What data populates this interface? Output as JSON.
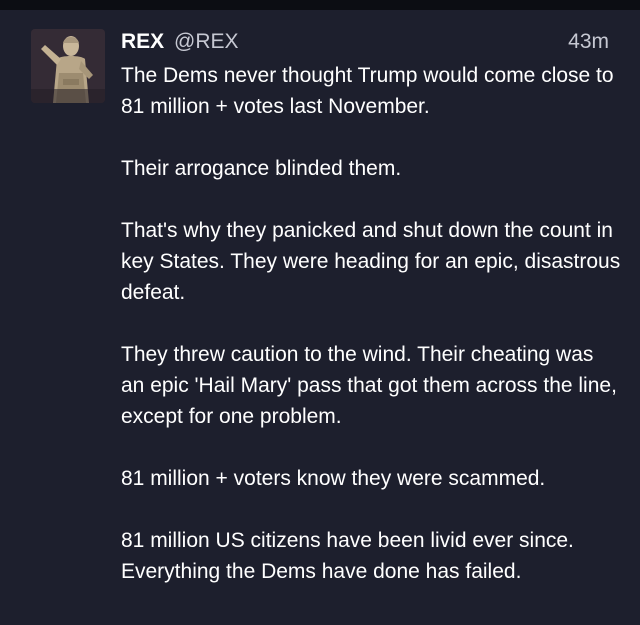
{
  "post": {
    "display_name": "REX",
    "handle": "@REX",
    "timestamp": "43m",
    "paragraphs": [
      "The Dems never thought Trump would come close to 81 million + votes last November.",
      "Their arrogance blinded them.",
      "That's why they panicked and shut down the count in key States. They were heading for an epic, disastrous defeat.",
      "They threw caution to the wind. Their cheating was an epic 'Hail Mary' pass that got them across the line, except for one problem.",
      "81 million + voters know they were scammed.",
      "81 million US citizens have been livid ever since. Everything the Dems have done has failed."
    ]
  },
  "colors": {
    "background": "#1d1f2d",
    "top_bar": "#0c0d13",
    "text_primary": "#ffffff",
    "text_secondary": "#c6c8d2"
  },
  "icons": {
    "avatar": "statue-avatar"
  }
}
